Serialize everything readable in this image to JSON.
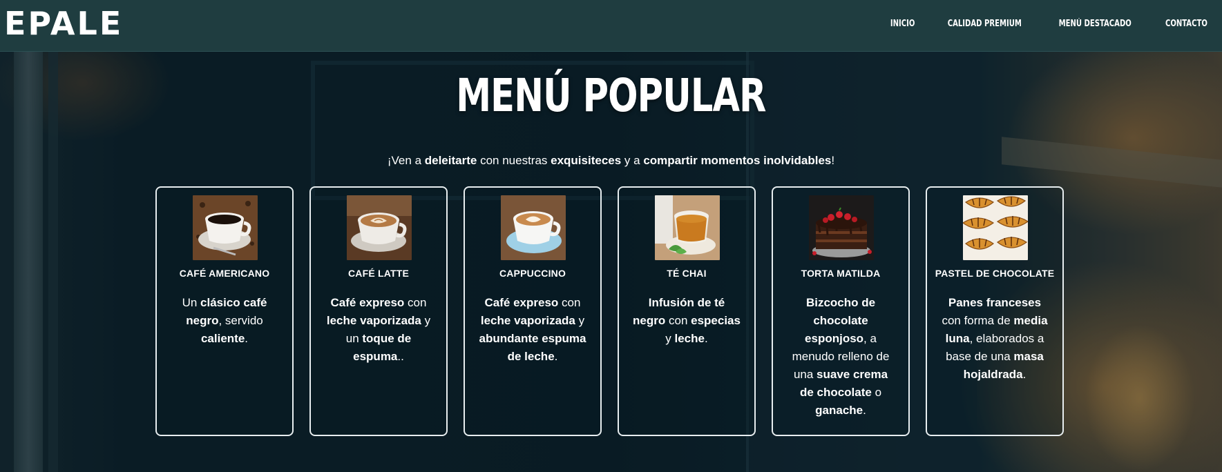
{
  "brand": {
    "logo_text": "EPALE"
  },
  "nav": {
    "items": [
      {
        "label": "INICIO"
      },
      {
        "label": "CALIDAD PREMIUM"
      },
      {
        "label": "MENÚ DESTACADO"
      },
      {
        "label": "CONTACTO"
      }
    ]
  },
  "hero": {
    "title": "MENÚ POPULAR",
    "subtitle_parts": [
      {
        "text": "¡Ven a ",
        "bold": false
      },
      {
        "text": "deleitarte",
        "bold": true
      },
      {
        "text": " con nuestras ",
        "bold": false
      },
      {
        "text": "exquisiteces",
        "bold": true
      },
      {
        "text": " y a ",
        "bold": false
      },
      {
        "text": "compartir momentos inolvidables",
        "bold": true
      },
      {
        "text": "!",
        "bold": false
      }
    ]
  },
  "cards": [
    {
      "title": "CAFÉ AMERICANO",
      "icon": "black-coffee-cup-photo",
      "desc": [
        {
          "text": "Un ",
          "bold": false
        },
        {
          "text": "clásico café negro",
          "bold": true
        },
        {
          "text": ", servido ",
          "bold": false
        },
        {
          "text": "caliente",
          "bold": true
        },
        {
          "text": ".",
          "bold": false
        }
      ]
    },
    {
      "title": "CAFÉ LATTE",
      "icon": "latte-art-cup-photo",
      "desc": [
        {
          "text": "Café expreso",
          "bold": true
        },
        {
          "text": " con ",
          "bold": false
        },
        {
          "text": "leche vaporizada",
          "bold": true
        },
        {
          "text": " y un ",
          "bold": false
        },
        {
          "text": "toque de espuma",
          "bold": true
        },
        {
          "text": "..",
          "bold": false
        }
      ]
    },
    {
      "title": "CAPPUCCINO",
      "icon": "cappuccino-cup-photo",
      "desc": [
        {
          "text": "Café expreso",
          "bold": true
        },
        {
          "text": " con ",
          "bold": false
        },
        {
          "text": "leche vaporizada",
          "bold": true
        },
        {
          "text": " y ",
          "bold": false
        },
        {
          "text": "abundante espuma de leche",
          "bold": true
        },
        {
          "text": ".",
          "bold": false
        }
      ]
    },
    {
      "title": "TÉ CHAI",
      "icon": "chai-tea-cup-photo",
      "desc": [
        {
          "text": "Infusión de té negro",
          "bold": true
        },
        {
          "text": " con ",
          "bold": false
        },
        {
          "text": "especias",
          "bold": true
        },
        {
          "text": " y ",
          "bold": false
        },
        {
          "text": "leche",
          "bold": true
        },
        {
          "text": ".",
          "bold": false
        }
      ]
    },
    {
      "title": "TORTA MATILDA",
      "icon": "chocolate-cake-photo",
      "desc": [
        {
          "text": "Bizcocho de chocolate esponjoso",
          "bold": true
        },
        {
          "text": ", a menudo relleno de una ",
          "bold": false
        },
        {
          "text": "suave crema de chocolate",
          "bold": true
        },
        {
          "text": " o ",
          "bold": false
        },
        {
          "text": "ganache",
          "bold": true
        },
        {
          "text": ".",
          "bold": false
        }
      ]
    },
    {
      "title": "PASTEL DE CHOCOLATE",
      "icon": "croissants-photo",
      "desc": [
        {
          "text": "Panes franceses",
          "bold": true
        },
        {
          "text": " con forma de ",
          "bold": false
        },
        {
          "text": "media luna",
          "bold": true
        },
        {
          "text": ", elaborados a base de una ",
          "bold": false
        },
        {
          "text": "masa hojaldrada",
          "bold": true
        },
        {
          "text": ".",
          "bold": false
        }
      ]
    }
  ],
  "colors": {
    "header_bg": "#1f3d40",
    "text": "#ffffff",
    "card_border": "#e8eef0"
  }
}
